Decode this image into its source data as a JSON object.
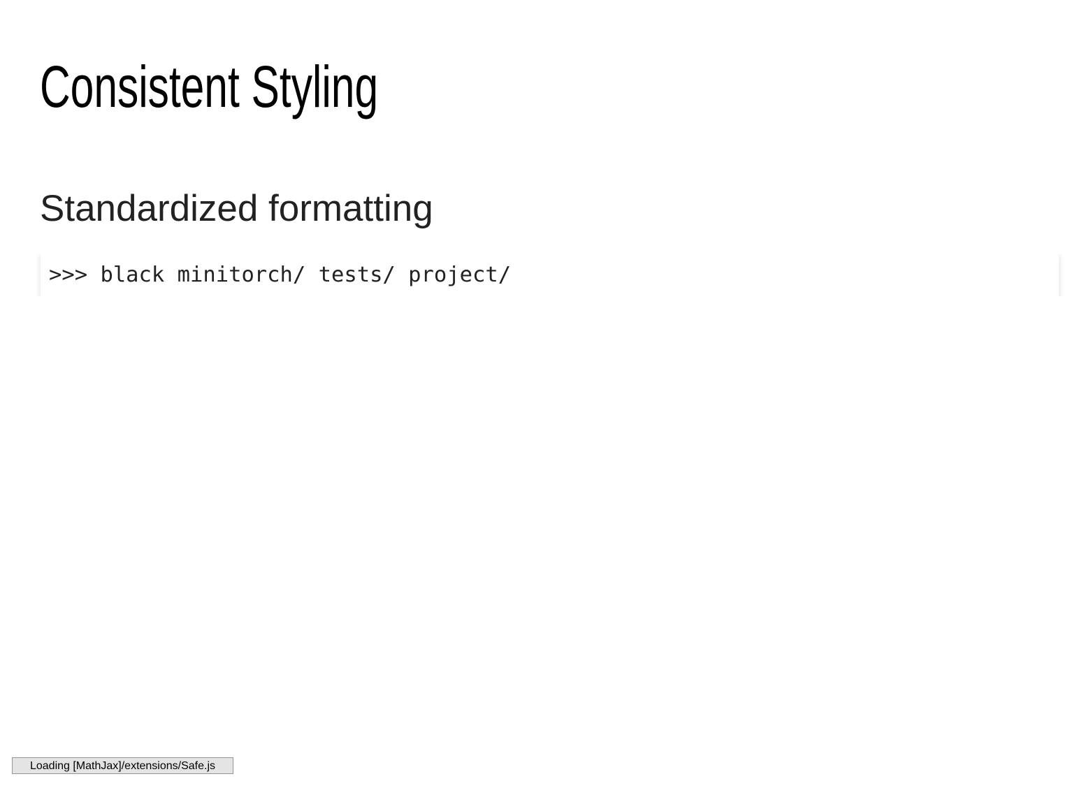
{
  "slide": {
    "title": "Consistent Styling",
    "subtitle": "Standardized formatting",
    "code": ">>> black minitorch/ tests/ project/"
  },
  "status": {
    "mathjax_message": "Loading [MathJax]/extensions/Safe.js"
  }
}
